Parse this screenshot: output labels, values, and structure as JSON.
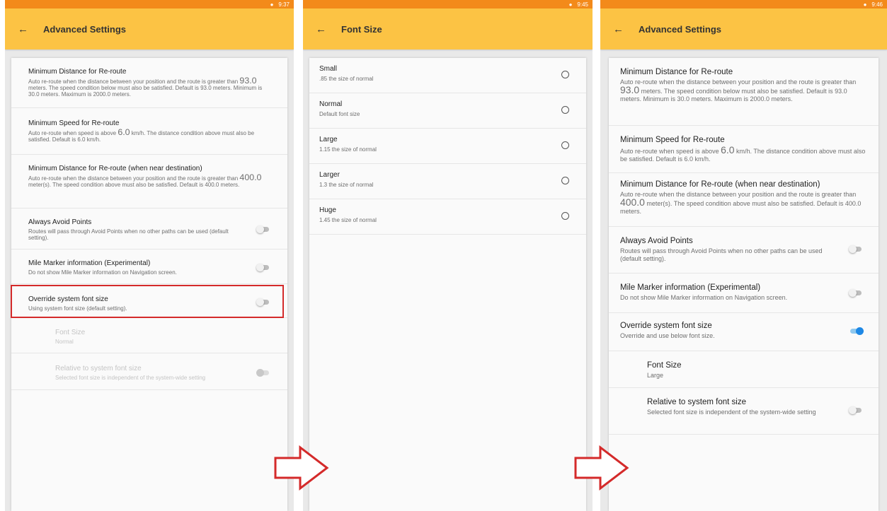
{
  "status_bar": {
    "time1": "9:37",
    "time2": "9:45",
    "time3": "9:46"
  },
  "screen1": {
    "title": "Advanced Settings",
    "items": [
      {
        "title": "Minimum Distance for Re-route",
        "sub_a": "Auto re-route when the distance between your position and the route is greater than ",
        "value": "93.0",
        "sub_b": " meters. The speed condition below must also be satisfied. Default is 93.0 meters. Minimum is 30.0 meters. Maximum is 2000.0 meters."
      },
      {
        "title": "Minimum Speed for Re-route",
        "sub_a": "Auto re-route when speed is above ",
        "value": "6.0",
        "sub_b": " km/h. The distance condition above must also be satisfied. Default is 6.0 km/h."
      },
      {
        "title": "Minimum Distance for Re-route (when near destination)",
        "sub_a": "Auto re-route when the distance between your position and the route is greater than ",
        "value": "400.0",
        "sub_b": " meter(s). The speed condition above must also be satisfied. Default is 400.0 meters."
      },
      {
        "title": "Always Avoid Points",
        "sub": "Routes will pass through Avoid Points when no other paths can be used (default setting)."
      },
      {
        "title": "Mile Marker information (Experimental)",
        "sub": "Do not show Mile Marker information on Navigation screen."
      },
      {
        "title": "Override system font size",
        "sub": "Using system font size (default setting)."
      },
      {
        "title": "Font Size",
        "sub": "Normal"
      },
      {
        "title": "Relative to system font size",
        "sub": "Selected font size is independent of the system-wide setting"
      }
    ]
  },
  "screen2": {
    "title": "Font Size",
    "options": [
      {
        "label": "Small",
        "desc": ".85 the size of normal"
      },
      {
        "label": "Normal",
        "desc": "Default font size"
      },
      {
        "label": "Large",
        "desc": "1.15 the size of normal"
      },
      {
        "label": "Larger",
        "desc": "1.3 the size of normal"
      },
      {
        "label": "Huge",
        "desc": "1.45 the size of normal"
      }
    ]
  },
  "screen3": {
    "title": "Advanced Settings",
    "items": [
      {
        "title": "Minimum Distance for Re-route",
        "sub_a": "Auto re-route when the distance between your position and the route is greater than ",
        "value": "93.0",
        "sub_b": " meters. The speed condition below must also be satisfied. Default is 93.0 meters. Minimum is 30.0 meters. Maximum is 2000.0 meters."
      },
      {
        "title": "Minimum Speed for Re-route",
        "sub_a": "Auto re-route when speed is above ",
        "value": "6.0",
        "sub_b": " km/h. The distance condition above must also be satisfied. Default is 6.0 km/h."
      },
      {
        "title": "Minimum Distance for Re-route (when near destination)",
        "sub_a": "Auto re-route when the distance between your position and the route is greater than ",
        "value": "400.0",
        "sub_b": " meter(s). The speed condition above must also be satisfied. Default is 400.0 meters."
      },
      {
        "title": "Always Avoid Points",
        "sub": "Routes will pass through Avoid Points when no other paths can be used (default setting)."
      },
      {
        "title": "Mile Marker information (Experimental)",
        "sub": "Do not show Mile Marker information on Navigation screen."
      },
      {
        "title": "Override system font size",
        "sub": "Override and use below font size."
      },
      {
        "title": "Font Size",
        "sub": "Large"
      },
      {
        "title": "Relative to system font size",
        "sub": "Selected font size is independent of the system-wide setting"
      }
    ]
  },
  "colors": {
    "status_bar": "#f38a1a",
    "app_bar": "#fcc344",
    "toggle_on": "#1e88e5",
    "highlight": "#d42a2a",
    "arrow": "#d42a2a"
  }
}
